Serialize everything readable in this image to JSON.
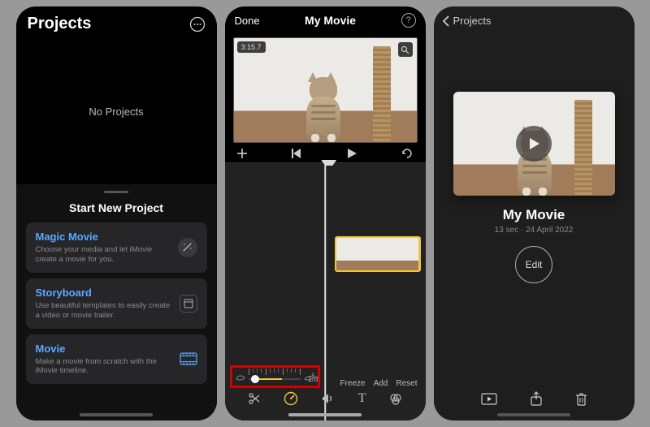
{
  "screen1": {
    "title": "Projects",
    "empty": "No Projects",
    "section": "Start New Project",
    "options": [
      {
        "title": "Magic Movie",
        "desc": "Choose your media and let iMovie create a movie for you."
      },
      {
        "title": "Storyboard",
        "desc": "Use beautiful templates to easily create a video or movie trailer."
      },
      {
        "title": "Movie",
        "desc": "Make a movie from scratch with the iMovie timeline."
      }
    ]
  },
  "screen2": {
    "done": "Done",
    "title": "My Movie",
    "clip_time": "3:15.7",
    "speed_value": "1/8",
    "speed_actions": {
      "freeze": "Freeze",
      "add": "Add",
      "reset": "Reset"
    }
  },
  "screen3": {
    "back": "Projects",
    "title": "My Movie",
    "meta": "13 sec · 24 April 2022",
    "edit": "Edit"
  }
}
